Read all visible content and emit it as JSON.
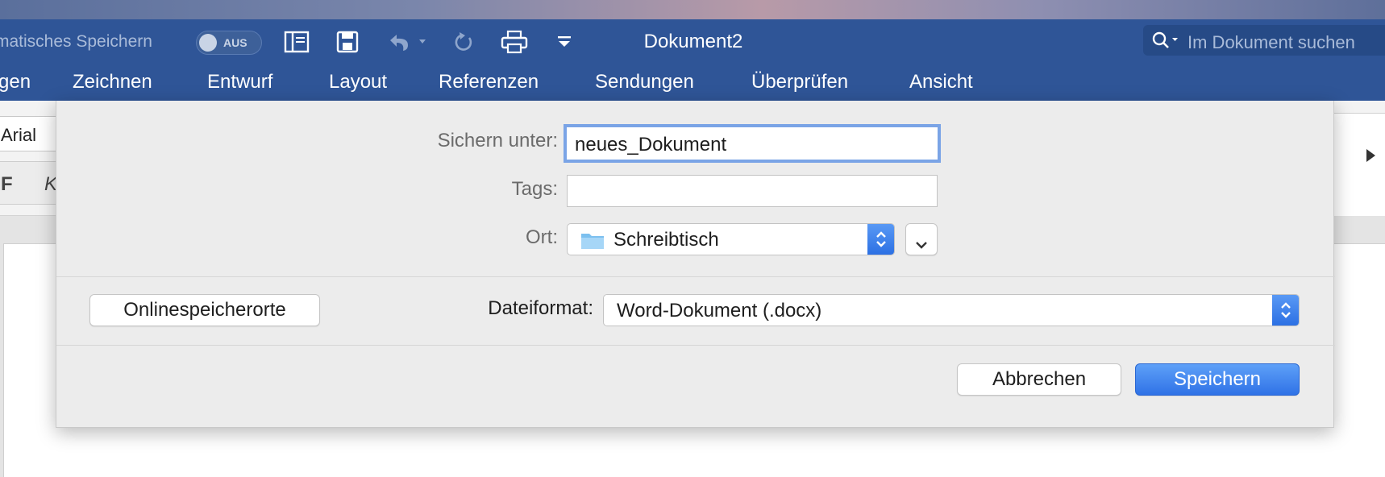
{
  "titlebar": {
    "autosave_label": "matisches Speichern",
    "autosave_toggle": "AUS",
    "document_title": "Dokument2",
    "search_placeholder": "Im Dokument suchen",
    "icons": [
      "sidebar-icon",
      "save-icon",
      "undo-icon",
      "redo-icon",
      "print-icon",
      "customize-toolbar-icon"
    ]
  },
  "ribbon": {
    "tabs": [
      "gen",
      "Zeichnen",
      "Entwurf",
      "Layout",
      "Referenzen",
      "Sendungen",
      "Überprüfen",
      "Ansicht"
    ],
    "font_name": "Arial",
    "bold_glyph": "F",
    "italic_glyph": "K"
  },
  "save_dialog": {
    "save_as_label": "Sichern unter:",
    "save_as_value": "neues_Dokument",
    "tags_label": "Tags:",
    "tags_value": "",
    "location_label": "Ort:",
    "location_value": "Schreibtisch",
    "online_locations_button": "Onlinespeicherorte",
    "format_label": "Dateiformat:",
    "format_value": "Word-Dokument (.docx)",
    "cancel_button": "Abbrechen",
    "save_button": "Speichern"
  },
  "colors": {
    "titlebar": "#2f5597",
    "accent_blue": "#2f72e6",
    "sheet_background": "#ececec"
  }
}
